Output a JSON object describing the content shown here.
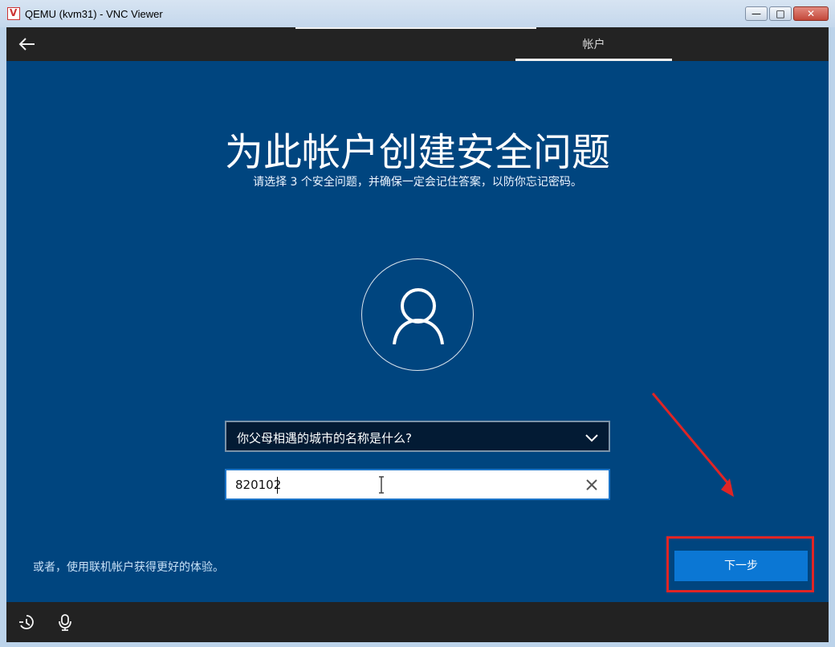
{
  "window": {
    "title": "QEMU (kvm31) - VNC Viewer"
  },
  "top": {
    "tab": "帐户"
  },
  "page": {
    "title": "为此帐户创建安全问题",
    "subtitle": "请选择 3 个安全问题，并确保一定会记住答案，以防你忘记密码。"
  },
  "question": {
    "selected": "你父母相遇的城市的名称是什么?"
  },
  "answer": {
    "value": "820102"
  },
  "footer": {
    "alternative": "或者，使用联机帐户获得更好的体验。",
    "next_label": "下一步"
  },
  "icons": {
    "back": "arrow-left-icon",
    "avatar": "user-icon",
    "dropdown": "chevron-down-icon",
    "clear": "close-icon",
    "accessibility": "accessibility-icon",
    "microphone": "microphone-icon"
  },
  "colors": {
    "background": "#00457f",
    "button": "#0b77d4",
    "annotation": "#e02525"
  }
}
